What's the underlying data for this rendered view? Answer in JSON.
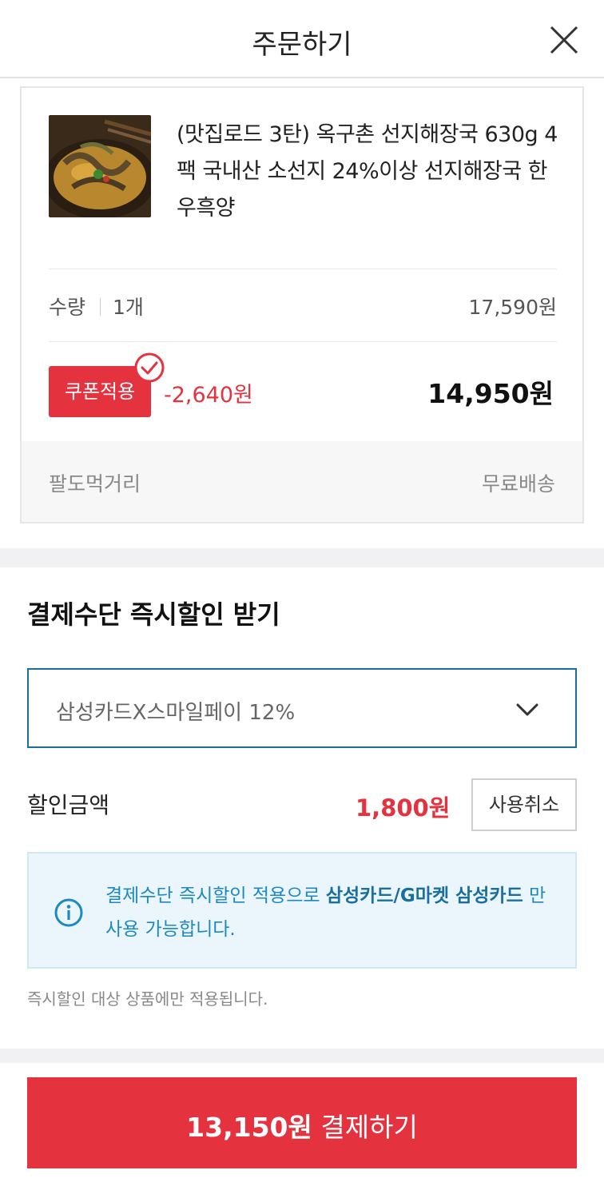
{
  "header": {
    "title": "주문하기",
    "close_icon": "close-icon"
  },
  "product": {
    "thumbnail_icon": "food-image",
    "name": "(맛집로드 3탄) 옥구촌 선지해장국 630g 4팩 국내산 소선지 24%이상 선지해장국 한우흑양",
    "quantity_label": "수량",
    "quantity_value": "1개",
    "list_price": "17,590원",
    "coupon_badge": "쿠폰적용",
    "coupon_discount": "-2,640원",
    "final_price": "14,950원",
    "seller": "팔도먹거리",
    "shipping": "무료배송"
  },
  "payment": {
    "title": "결제수단 즉시할인 받기",
    "selected_method": "삼성카드X스마일페이 12%",
    "discount_label": "할인금액",
    "discount_amount": "1,800원",
    "cancel_label": "사용취소",
    "info_text_prefix": "결제수단 즉시할인 적용으로 ",
    "info_text_strong": "삼성카드/G마켓 삼성카드",
    "info_text_suffix": " 만 사용 가능합니다.",
    "note": "즉시할인 대상 상품에만 적용됩니다."
  },
  "footer": {
    "pay_amount": "13,150원",
    "pay_label": " 결제하기"
  },
  "colors": {
    "accent_red": "#e4323e",
    "info_blue": "#1e88c5",
    "select_border": "#1a6ea0"
  }
}
